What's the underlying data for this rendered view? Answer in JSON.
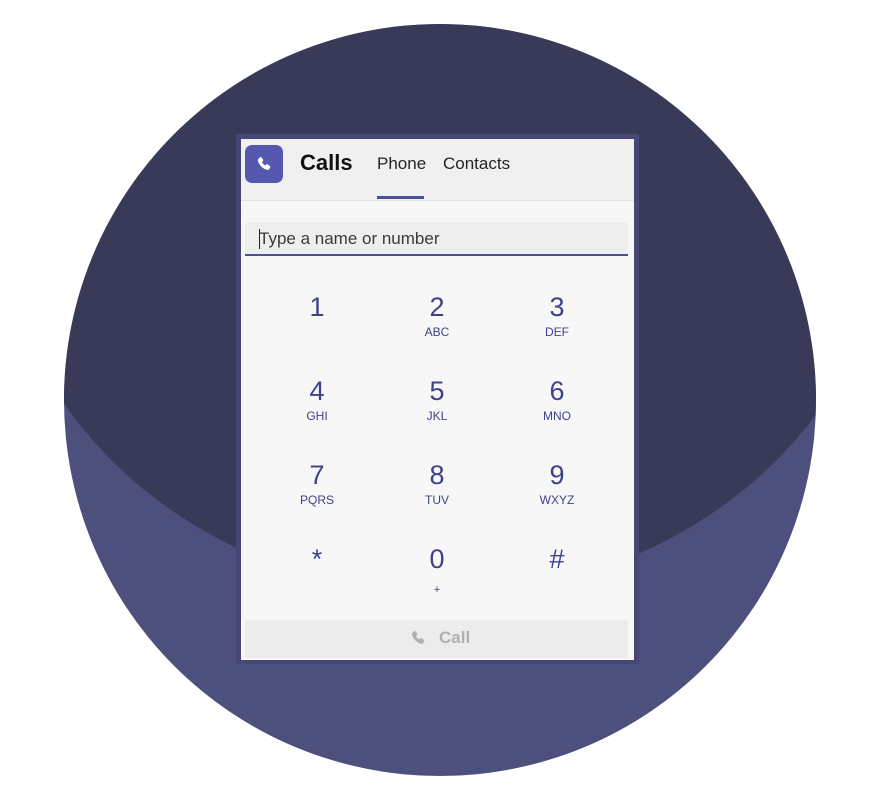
{
  "colors": {
    "background_circle": "#4d4f7c",
    "background_shadow": "#393a58",
    "brand_purple": "#4b4f9b",
    "panel": "#f7f7f7",
    "header": "#f0f0f0",
    "keypad_text": "#3f428a",
    "disabled_text": "#b0b0b0"
  },
  "app": {
    "title": "Calls",
    "logo_icon": "phone-icon"
  },
  "tabs": [
    {
      "label": "Phone",
      "selected": true
    },
    {
      "label": "Contacts",
      "selected": false
    }
  ],
  "search": {
    "placeholder": "Type a name or number",
    "value": ""
  },
  "keypad": {
    "keys": [
      {
        "digit": "1",
        "letters": ""
      },
      {
        "digit": "2",
        "letters": "ABC"
      },
      {
        "digit": "3",
        "letters": "DEF"
      },
      {
        "digit": "4",
        "letters": "GHI"
      },
      {
        "digit": "5",
        "letters": "JKL"
      },
      {
        "digit": "6",
        "letters": "MNO"
      },
      {
        "digit": "7",
        "letters": "PQRS"
      },
      {
        "digit": "8",
        "letters": "TUV"
      },
      {
        "digit": "9",
        "letters": "WXYZ"
      },
      {
        "digit": "*",
        "letters": ""
      },
      {
        "digit": "0",
        "letters": "+"
      },
      {
        "digit": "#",
        "letters": ""
      }
    ]
  },
  "call_button": {
    "label": "Call",
    "icon": "phone-icon",
    "disabled": true
  }
}
